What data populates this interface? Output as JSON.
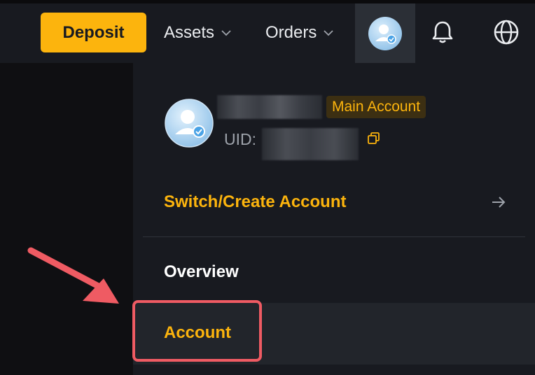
{
  "header": {
    "deposit_label": "Deposit",
    "nav": [
      {
        "label": "Assets"
      },
      {
        "label": "Orders"
      }
    ],
    "icons": [
      "user-avatar-icon",
      "bell-icon",
      "globe-icon"
    ]
  },
  "account_panel": {
    "badge": "Main Account",
    "uid_label": "UID:",
    "switch_label": "Switch/Create Account",
    "menu": [
      {
        "label": "Overview"
      },
      {
        "label": "Account"
      }
    ]
  },
  "colors": {
    "accent": "#fcb40d",
    "highlight": "#ef5b63",
    "panel_bg": "#181a20"
  }
}
